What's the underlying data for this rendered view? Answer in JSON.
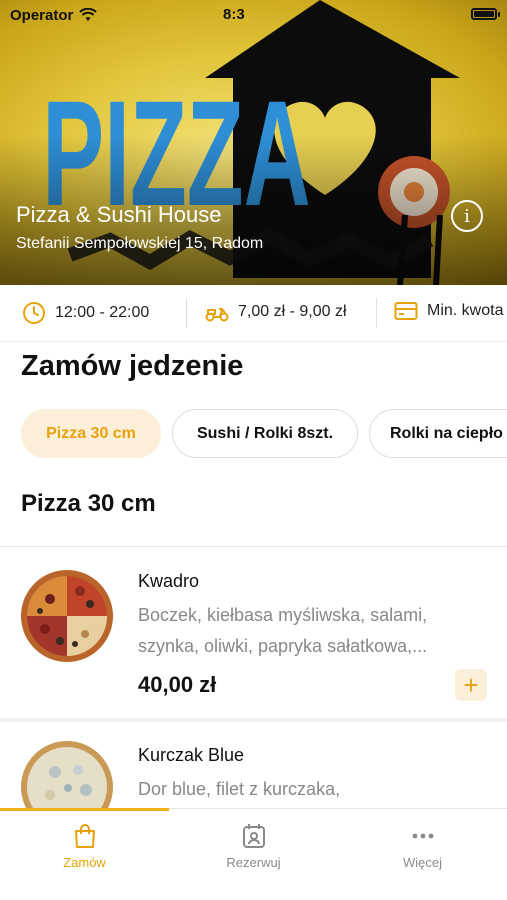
{
  "status_bar": {
    "carrier": "Operator",
    "time": "8:3"
  },
  "restaurant": {
    "name": "Pizza & Sushi House",
    "address": "Stefanii Sempołowskiej 15, Radom",
    "logo_text": "PIZZA"
  },
  "info": {
    "hours": "12:00 - 22:00",
    "delivery": "7,00 zł - 9,00 zł",
    "minimum": "Min. kwota"
  },
  "section_title": "Zamów jedzenie",
  "categories": [
    {
      "label": "Pizza 30 cm",
      "active": true
    },
    {
      "label": "Sushi / Rolki 8szt.",
      "active": false
    },
    {
      "label": "Rolki na ciepło",
      "active": false
    }
  ],
  "category_title": "Pizza 30 cm",
  "items": [
    {
      "name": "Kwadro",
      "description_line1": "Boczek, kiełbasa myśliwska, salami,",
      "description_line2": "szynka, oliwki, papryka sałatkowa,...",
      "price": "40,00 zł"
    },
    {
      "name": "Kurczak Blue",
      "description_line1": "Dor blue, filet z kurczaka,",
      "description_line2": "",
      "price": ""
    }
  ],
  "tabs": [
    {
      "label": "Zamów",
      "icon": "bag-icon",
      "active": true
    },
    {
      "label": "Rezerwuj",
      "icon": "calendar-person-icon",
      "active": false
    },
    {
      "label": "Więcej",
      "icon": "more-dots-icon",
      "active": false
    }
  ],
  "colors": {
    "accent": "#E6A20A",
    "accent_soft": "#FBEFD9",
    "logo_blue": "#2E8FD6"
  }
}
